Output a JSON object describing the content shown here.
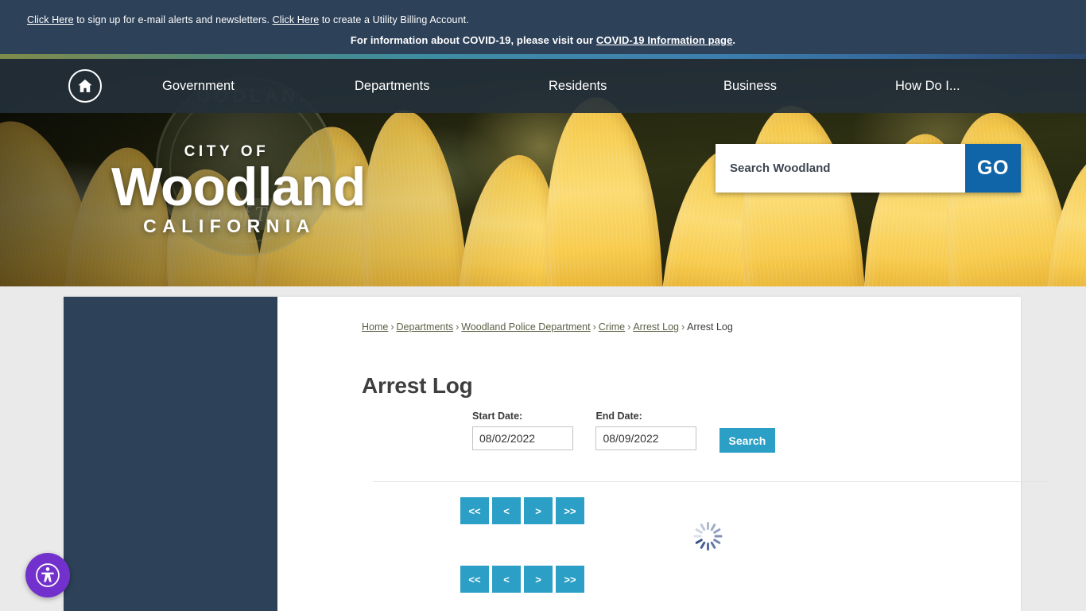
{
  "alert_bar": {
    "line1": {
      "link1": "Click Here",
      "text1": " to sign up for e-mail alerts and newsletters. ",
      "link2": "Click Here",
      "text2": " to create a Utility Billing Account."
    },
    "line2": {
      "text1": "For information about COVID-19, please visit our ",
      "link": "COVID-19 Information page",
      "text2": "."
    },
    "background_color": "#2d4159"
  },
  "nav": {
    "home_icon": "home-icon",
    "items": [
      {
        "label": "Government"
      },
      {
        "label": "Departments"
      },
      {
        "label": "Residents"
      },
      {
        "label": "Business"
      },
      {
        "label": "How Do I..."
      }
    ]
  },
  "hero": {
    "logo": {
      "line1": "CITY OF",
      "line2": "Woodland",
      "line3": "CALIFORNIA"
    },
    "seal": {
      "word": "WOODLAND",
      "motto": "City of Trees"
    }
  },
  "search": {
    "placeholder": "Search Woodland",
    "value": "",
    "button_label": "GO",
    "button_color": "#1065a8"
  },
  "breadcrumb": {
    "items": [
      {
        "label": "Home",
        "link": true
      },
      {
        "label": "Departments",
        "link": true
      },
      {
        "label": "Woodland Police Department",
        "link": true
      },
      {
        "label": "Crime",
        "link": true
      },
      {
        "label": "Arrest Log",
        "link": true
      },
      {
        "label": "Arrest Log",
        "link": false
      }
    ],
    "separator": "›"
  },
  "page": {
    "title": "Arrest Log"
  },
  "filter_form": {
    "start_date": {
      "label": "Start Date:",
      "value": "08/02/2022"
    },
    "end_date": {
      "label": "End Date:",
      "value": "08/09/2022"
    },
    "search_button": "Search",
    "accent_color": "#2b9fc5"
  },
  "pagination": {
    "first": "<<",
    "prev": "<",
    "next": ">",
    "last": ">>"
  },
  "results": {
    "status": "loading",
    "spinner_color": "#38538c"
  },
  "accessibility_widget": {
    "icon": "accessibility-person-icon",
    "color": "#7231cc"
  },
  "theme": {
    "page_background": "#eaeaea",
    "panel_background": "#ffffff",
    "sidebar_color": "#2d4159"
  }
}
